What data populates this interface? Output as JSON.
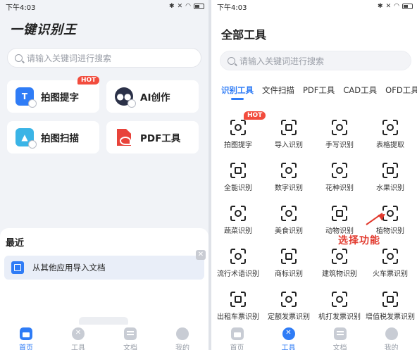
{
  "left": {
    "status": {
      "time": "下午4:03"
    },
    "app_title": "一键识别王",
    "search": {
      "placeholder": "请输入关键词进行搜索"
    },
    "features": [
      {
        "label": "拍图提字",
        "badge": "HOT",
        "icon": "text-image-icon"
      },
      {
        "label": "AI创作",
        "icon": "robot-icon"
      },
      {
        "label": "拍图扫描",
        "icon": "image-scan-icon"
      },
      {
        "label": "PDF工具",
        "icon": "pdf-icon"
      }
    ],
    "recent": {
      "title": "最近",
      "import_label": "从其他应用导入文档"
    },
    "tabbar": [
      {
        "label": "首页",
        "active": true
      },
      {
        "label": "工具"
      },
      {
        "label": "文档"
      },
      {
        "label": "我的"
      }
    ]
  },
  "right": {
    "status": {
      "time": "下午4:03"
    },
    "page_title": "全部工具",
    "search": {
      "placeholder": "请输入关键词进行搜索"
    },
    "categories": [
      "识别工具",
      "文件扫描",
      "PDF工具",
      "CAD工具",
      "OFD工具"
    ],
    "tools": [
      {
        "label": "拍图提字",
        "badge": "HOT"
      },
      {
        "label": "导入识别"
      },
      {
        "label": "手写识别"
      },
      {
        "label": "表格提取"
      },
      {
        "label": "全能识别"
      },
      {
        "label": "数字识别"
      },
      {
        "label": "花种识别"
      },
      {
        "label": "水果识别"
      },
      {
        "label": "蔬菜识别"
      },
      {
        "label": "美食识别"
      },
      {
        "label": "动物识别"
      },
      {
        "label": "植物识别"
      },
      {
        "label": "流行术语识别"
      },
      {
        "label": "商标识别"
      },
      {
        "label": "建筑物识别"
      },
      {
        "label": "火车票识别"
      },
      {
        "label": "出租车票识别"
      },
      {
        "label": "定额发票识别"
      },
      {
        "label": "机打发票识别"
      },
      {
        "label": "增值税发票识别"
      }
    ],
    "annotation": "选择功能",
    "tabbar": [
      {
        "label": "首页"
      },
      {
        "label": "工具",
        "active": true
      },
      {
        "label": "文档"
      },
      {
        "label": "我的"
      }
    ]
  },
  "colors": {
    "accent": "#2f7cf6",
    "hot": "#f24c3d",
    "annotation": "#e23a2e"
  }
}
